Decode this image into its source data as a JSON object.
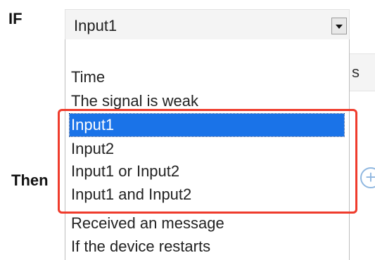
{
  "condition": {
    "if_label": "IF",
    "then_label": "Then",
    "selected_value": "Input1",
    "background_field_text": "s",
    "options": [
      "Time",
      "The signal is weak",
      "Input1",
      "Input2",
      "Input1 or Input2",
      "Input1 and Input2",
      "Received an message",
      "If the device restarts"
    ],
    "selected_index": 2
  },
  "colors": {
    "selection": "#1a73e8",
    "highlight_border": "#ef3b2c",
    "add_icon": "#8fb7e0"
  },
  "icons": {
    "dropdown": "chevron-down-icon",
    "add": "plus-circle-icon"
  }
}
